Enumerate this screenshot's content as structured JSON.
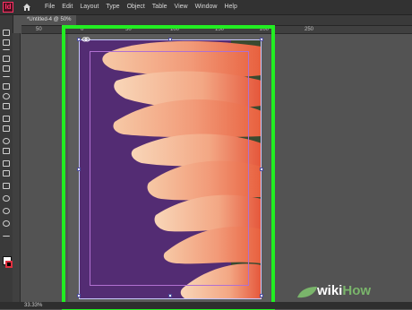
{
  "app": {
    "icon_text": "Id",
    "brand_color": "#ff3366"
  },
  "menu": {
    "items": [
      "File",
      "Edit",
      "Layout",
      "Type",
      "Object",
      "Table",
      "View",
      "Window",
      "Help"
    ]
  },
  "document": {
    "tab_title": "*Untitled-4 @ 50%"
  },
  "ruler": {
    "labels": [
      "50",
      "0",
      "50",
      "100",
      "150",
      "200",
      "250"
    ]
  },
  "status": {
    "zoom": "33.33%"
  },
  "canvas": {
    "frame_color": "#532c73",
    "highlight_color": "#22ee22"
  },
  "watermark": {
    "prefix": "wiki",
    "brand": "How"
  },
  "icons": {
    "home": "home-icon",
    "link": "link-icon",
    "tools": [
      "selection-tool-icon",
      "direct-selection-tool-icon",
      "page-tool-icon",
      "gap-tool-icon",
      "content-collector-icon",
      "type-tool-icon",
      "line-tool-icon",
      "pen-tool-icon",
      "pencil-tool-icon",
      "rectangle-frame-tool-icon",
      "rectangle-tool-icon",
      "scissors-tool-icon",
      "free-transform-tool-icon",
      "gradient-swatch-tool-icon",
      "gradient-feather-tool-icon",
      "note-tool-icon",
      "eyedropper-tool-icon",
      "hand-tool-icon",
      "zoom-tool-icon",
      "swap-colors-icon"
    ]
  }
}
